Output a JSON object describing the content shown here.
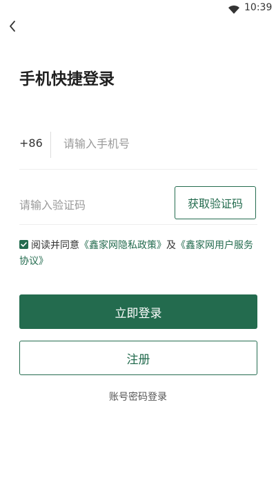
{
  "status_bar": {
    "time": "10:39",
    "wifi_icon": "wifi-icon"
  },
  "nav": {
    "back_icon": "chevron-left-icon"
  },
  "title": "手机快捷登录",
  "phone": {
    "country_code": "+86",
    "placeholder": "请输入手机号",
    "value": ""
  },
  "code": {
    "placeholder": "请输入验证码",
    "value": "",
    "get_code_label": "获取验证码"
  },
  "agreement": {
    "checked": true,
    "prefix": "阅读并同意",
    "privacy_link": "《鑫家网隐私政策》",
    "joiner": "及",
    "service_link": "《鑫家网用户服务协议》"
  },
  "buttons": {
    "login_label": "立即登录",
    "register_label": "注册"
  },
  "password_login_label": "账号密码登录",
  "colors": {
    "accent": "#236b4e",
    "background": "#ffffff"
  }
}
